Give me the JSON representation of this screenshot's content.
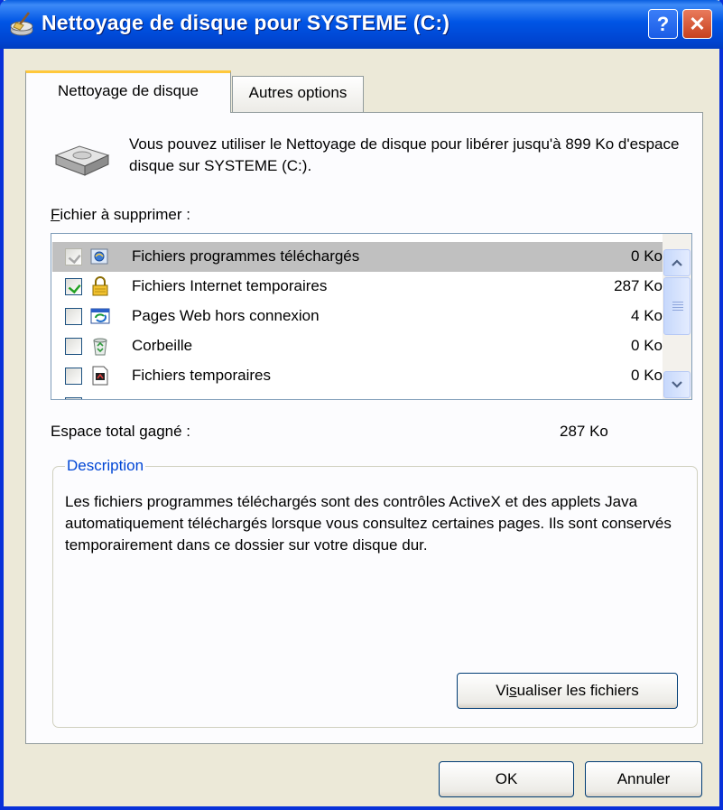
{
  "window": {
    "title": "Nettoyage de disque pour SYSTEME (C:)",
    "help_label": "?",
    "close_label": "✕"
  },
  "tabs": [
    {
      "label": "Nettoyage de disque",
      "active": true
    },
    {
      "label": "Autres options",
      "active": false
    }
  ],
  "intro": {
    "text": "Vous pouvez utiliser le Nettoyage de disque pour libérer jusqu'à 899 Ko d'espace disque sur SYSTEME (C:)."
  },
  "files_label": {
    "accel": "F",
    "rest": "ichier à supprimer :"
  },
  "files": [
    {
      "name": "Fichiers programmes téléchargés",
      "size": "0 Ko",
      "checked": true,
      "disabled": true,
      "icon": "activex-icon"
    },
    {
      "name": "Fichiers Internet temporaires",
      "size": "287 Ko",
      "checked": true,
      "disabled": false,
      "icon": "lock-icon"
    },
    {
      "name": "Pages Web hors connexion",
      "size": "4 Ko",
      "checked": false,
      "disabled": false,
      "icon": "offline-pages-icon"
    },
    {
      "name": "Corbeille",
      "size": "0 Ko",
      "checked": false,
      "disabled": false,
      "icon": "recycle-bin-icon"
    },
    {
      "name": "Fichiers temporaires",
      "size": "0 Ko",
      "checked": false,
      "disabled": false,
      "icon": "temp-files-icon"
    }
  ],
  "total": {
    "label": "Espace total gagné :",
    "value": "287 Ko"
  },
  "description": {
    "title": "Description",
    "text": "Les fichiers programmes téléchargés sont des contrôles ActiveX et des applets Java automatiquement téléchargés lorsque vous consultez certaines pages. Ils sont conservés temporairement dans ce dossier sur votre disque dur."
  },
  "buttons": {
    "view_pre": "Vi",
    "view_accel": "s",
    "view_post": "ualiser les fichiers",
    "ok": "OK",
    "cancel": "Annuler"
  },
  "colors": {
    "titlebar": "#0055E5",
    "dialog_bg": "#ECE9D8",
    "tab_highlight": "#FFC83C",
    "group_title": "#0046D5"
  }
}
